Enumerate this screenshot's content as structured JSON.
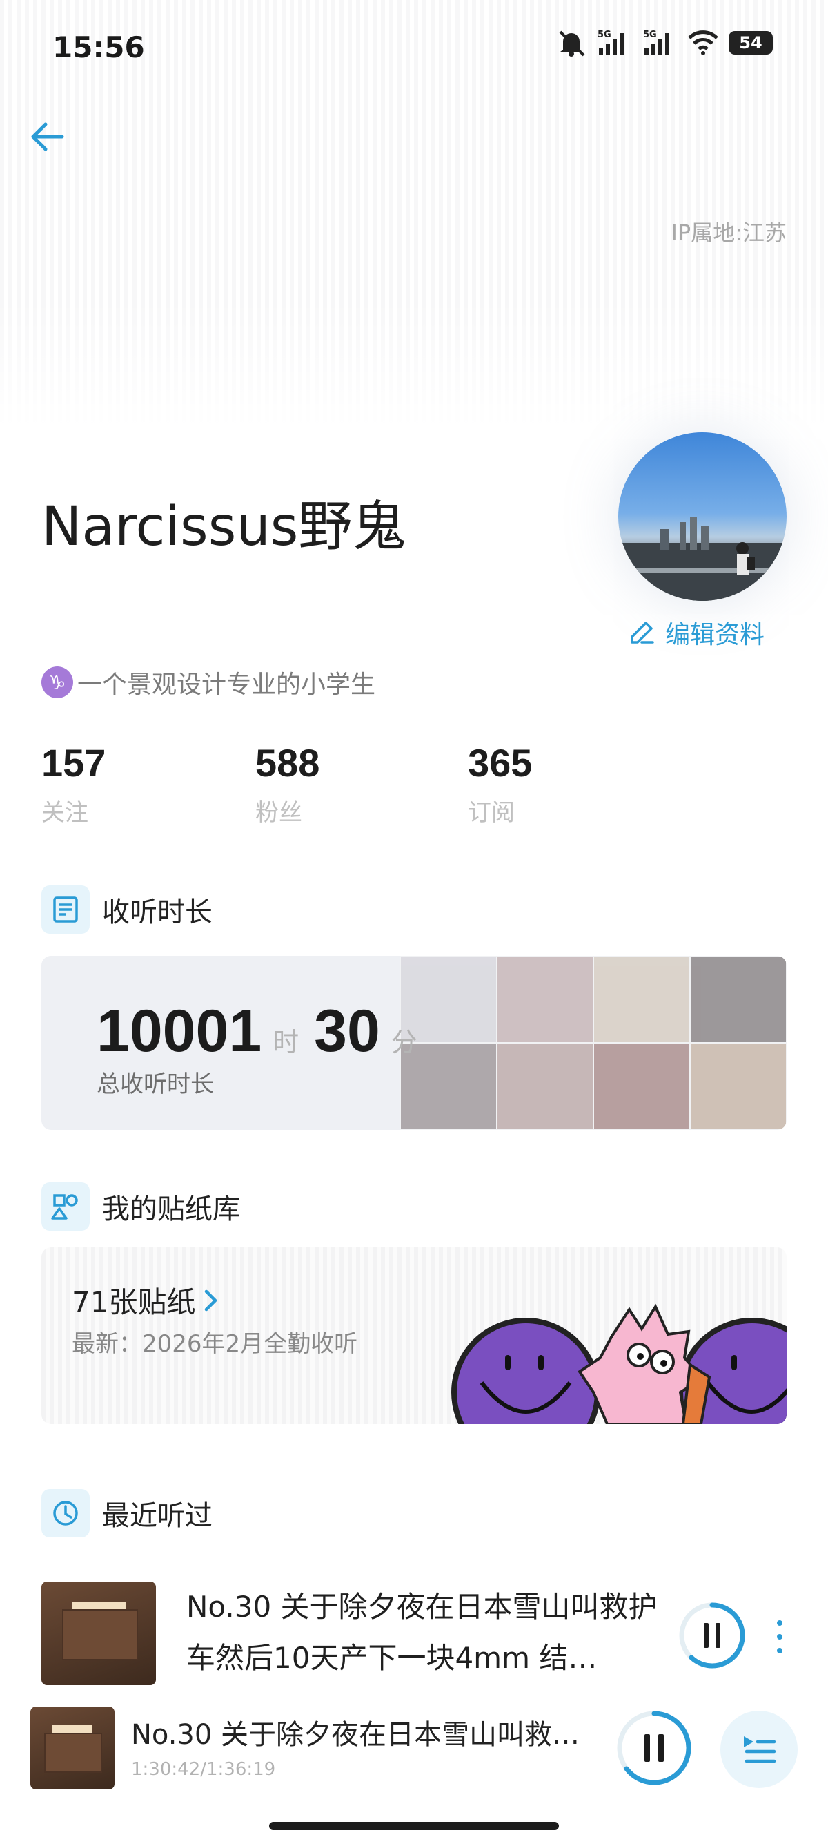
{
  "status_bar": {
    "time": "15:56",
    "battery": "54",
    "signal_label_1": "5G",
    "signal_label_2": "5G"
  },
  "profile": {
    "ip_location": "IP属地:江苏",
    "name": "Narcissus野鬼",
    "edit_label": "编辑资料",
    "zodiac_symbol": "♑",
    "bio": "一个景观设计专业的小学生"
  },
  "stats": [
    {
      "value": "157",
      "label": "关注"
    },
    {
      "value": "588",
      "label": "粉丝"
    },
    {
      "value": "365",
      "label": "订阅"
    }
  ],
  "listen": {
    "section_title": "收听时长",
    "hours": "10001",
    "hours_unit": "时",
    "minutes": "30",
    "minutes_unit": "分",
    "subtitle": "总收听时长"
  },
  "stickers": {
    "section_title": "我的贴纸库",
    "count_label": "71张贴纸",
    "latest": "最新：2026年2月全勤收听"
  },
  "recent": {
    "section_title": "最近听过",
    "item_title": "No.30 关于除夕夜在日本雪山叫救护车然后10天产下一块4mm 结…"
  },
  "player": {
    "title": "No.30 关于除夕夜在日本雪山叫救护…",
    "time": "1:30:42/1:36:19"
  },
  "colors": {
    "accent": "#2a9bd5",
    "zodiac": "#a57ad8",
    "sticker_face": "#7a4fc0"
  }
}
